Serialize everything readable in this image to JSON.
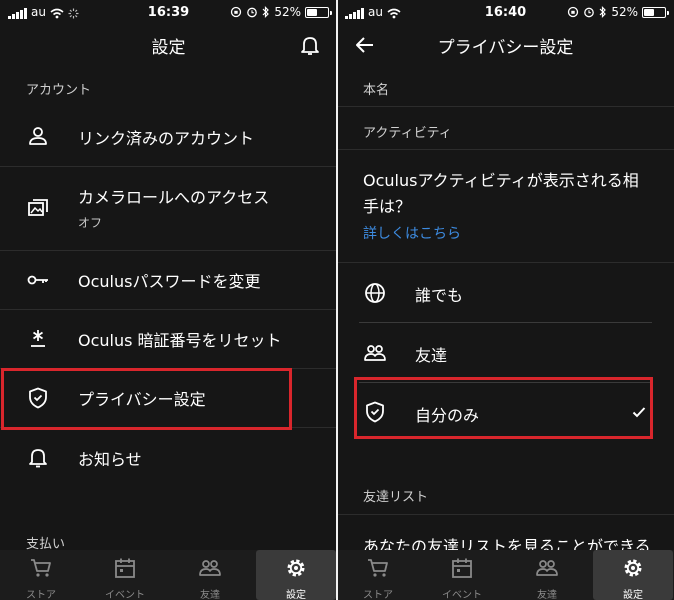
{
  "left": {
    "status": {
      "carrier": "au",
      "time": "16:39",
      "battery": "52%"
    },
    "header": {
      "title": "設定"
    },
    "account_section": "アカウント",
    "items": [
      {
        "label": "リンク済みのアカウント",
        "icon": "person-icon"
      },
      {
        "label": "カメラロールへのアクセス",
        "sub": "オフ",
        "icon": "photos-icon"
      },
      {
        "label": "Oculusパスワードを変更",
        "icon": "key-icon"
      },
      {
        "label": "Oculus 暗証番号をリセット",
        "icon": "asterisk-icon"
      },
      {
        "label": "プライバシー設定",
        "icon": "shield-icon"
      },
      {
        "label": "お知らせ",
        "icon": "bell-icon"
      }
    ],
    "payment_section": "支払い"
  },
  "right": {
    "status": {
      "carrier": "au",
      "time": "16:40",
      "battery": "52%"
    },
    "header": {
      "title": "プライバシー設定"
    },
    "real_name_section": "本名",
    "activity_section": "アクティビティ",
    "question_line1": "Oculusアクティビティが表示される相",
    "question_line2": "手は？",
    "learn_more": "詳しくはこちら",
    "options": [
      {
        "label": "誰でも",
        "icon": "globe-icon",
        "selected": false
      },
      {
        "label": "友達",
        "icon": "people-icon",
        "selected": false
      },
      {
        "label": "自分のみ",
        "icon": "shield-icon",
        "selected": true
      }
    ],
    "friends_list_section": "友達リスト",
    "friends_question": "あなたの友達リストを見ることができる"
  },
  "tabs": [
    {
      "label": "ストア",
      "icon": "cart-icon"
    },
    {
      "label": "イベント",
      "icon": "calendar-icon"
    },
    {
      "label": "友達",
      "icon": "people-icon"
    },
    {
      "label": "設定",
      "icon": "gear-icon",
      "active": true
    }
  ],
  "colors": {
    "background": "#161616",
    "highlight": "#d9262c",
    "link": "#3d8be0"
  }
}
